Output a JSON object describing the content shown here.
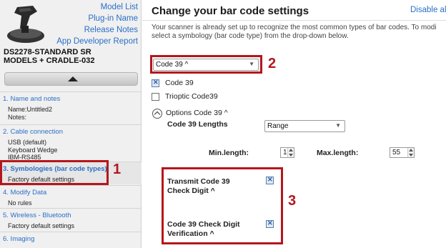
{
  "sidebar": {
    "links": [
      "Model List",
      "Plug-in Name",
      "Release Notes",
      "App Developer Report"
    ],
    "device_name_line1": "DS2278-STANDARD SR",
    "device_name_line2": "MODELS + CRADLE-032",
    "steps": [
      {
        "title": "1.  Name and notes",
        "details": [
          "Name:Untitled2",
          "Notes:"
        ]
      },
      {
        "title": "2.  Cable connection",
        "details": [
          "USB (default)",
          "Keyboard Wedge",
          "IBM-RS485"
        ]
      },
      {
        "title": "3.  Symbologies (bar code types)",
        "details": [
          "Factory default settings"
        ]
      },
      {
        "title": "4.  Modify Data",
        "details": [
          "No rules"
        ]
      },
      {
        "title": "5.  Wireless - Bluetooth",
        "details": [
          "Factory default settings"
        ]
      },
      {
        "title": "6.  Imaging",
        "details": []
      }
    ]
  },
  "main": {
    "title": "Change your bar code settings",
    "disable_all": "Disable all",
    "description_line1": "Your scanner is already set up to recognize the most common types of bar codes. To modi",
    "description_line2": "select a symbology (bar code type) from the drop-down below.",
    "symbology_select": "Code 39 ^",
    "checkboxes": [
      {
        "label": "Code 39",
        "checked": true
      },
      {
        "label": "Trioptic Code39",
        "checked": false
      }
    ],
    "options_toggle": "Options Code 39 ^",
    "lengths_label": "Code 39 Lengths",
    "lengths_select": "Range",
    "min_length_label": "Min.length:",
    "min_length_value": "1",
    "max_length_label": "Max.length:",
    "max_length_value": "55",
    "transmit_label_line1": "Transmit Code 39",
    "transmit_label_line2": "Check Digit ^",
    "transmit_checked": true,
    "verify_label_line1": "Code 39 Check Digit",
    "verify_label_line2": "Verification ^",
    "verify_checked": true
  },
  "callouts": [
    "1",
    "2",
    "3"
  ],
  "colors": {
    "link": "#2a6fc7",
    "callout_red": "#b5161c"
  }
}
